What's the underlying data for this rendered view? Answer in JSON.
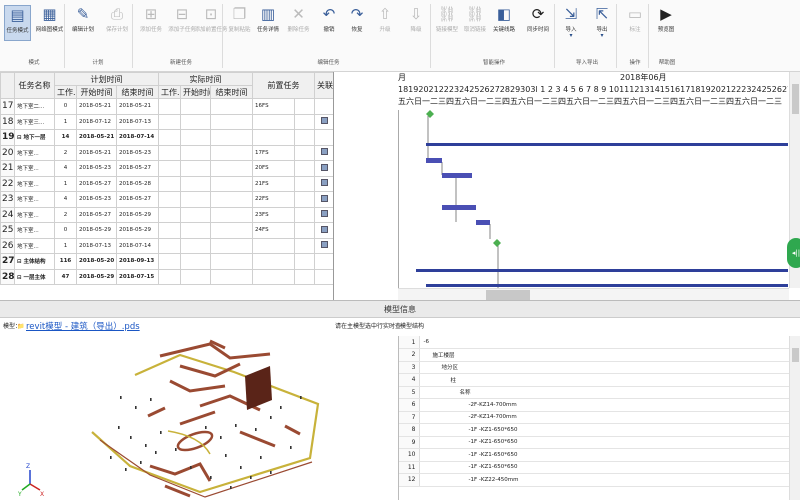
{
  "ribbon": {
    "buttons": [
      {
        "id": "task-mode",
        "label": "任务模式",
        "group": "mode",
        "active": true
      },
      {
        "id": "network-mode",
        "label": "网络图模式",
        "group": "mode"
      },
      {
        "id": "edit-plan",
        "label": "编辑计划",
        "group": "plan"
      },
      {
        "id": "save-plan",
        "label": "保存计划",
        "group": "plan",
        "disabled": true
      },
      {
        "id": "add-task",
        "label": "添加任务",
        "group": "new",
        "disabled": true
      },
      {
        "id": "add-subtask",
        "label": "添加子任务",
        "group": "new",
        "disabled": true
      },
      {
        "id": "add-preceding",
        "label": "添加前置任务",
        "group": "new",
        "disabled": true
      },
      {
        "id": "copy-paste",
        "label": "复制粘贴",
        "group": "edit",
        "disabled": true
      },
      {
        "id": "task-detail",
        "label": "任务详情",
        "group": "edit"
      },
      {
        "id": "delete-task",
        "label": "删除任务",
        "group": "edit",
        "disabled": true
      },
      {
        "id": "undo",
        "label": "撤销",
        "group": "edit"
      },
      {
        "id": "redo",
        "label": "恢复",
        "group": "edit"
      },
      {
        "id": "upgrade",
        "label": "升级",
        "group": "edit",
        "disabled": true
      },
      {
        "id": "downgrade",
        "label": "降级",
        "group": "edit",
        "disabled": true
      },
      {
        "id": "link-model",
        "label": "链接模型",
        "group": "smart",
        "disabled": true
      },
      {
        "id": "unlink",
        "label": "取消链接",
        "group": "smart",
        "disabled": true
      },
      {
        "id": "key-path",
        "label": "关键线路",
        "group": "smart"
      },
      {
        "id": "sync-time",
        "label": "同步时间",
        "group": "smart"
      },
      {
        "id": "import",
        "label": "导入",
        "group": "io",
        "dropdown": true
      },
      {
        "id": "export",
        "label": "导出",
        "group": "io",
        "dropdown": true
      },
      {
        "id": "mark",
        "label": "标注",
        "group": "ops",
        "disabled": true
      },
      {
        "id": "simulate",
        "label": "预览图",
        "group": "help"
      }
    ],
    "groups": {
      "mode": "模式",
      "plan": "计划",
      "new": "新建任务",
      "edit": "编辑任务",
      "smart": "智能操作",
      "io": "导入导出",
      "ops": "操作",
      "help": "帮助图"
    }
  },
  "grid": {
    "header_top": {
      "name": "任务名称",
      "plan": "计划时间",
      "actual": "实际时间",
      "pred": "前置任务",
      "assoc": "关联..."
    },
    "header_sub": {
      "work": "工作...",
      "start": "开始时间",
      "end": "结束时间",
      "awork": "工作...",
      "astart": "开始时间",
      "aend": "结束时间"
    },
    "rows": [
      {
        "num": "17",
        "name": "地下室二...",
        "work": "0",
        "start": "2018-05-21",
        "end": "2018-05-21",
        "pred": "16FS",
        "assoc": false
      },
      {
        "num": "18",
        "name": "地下室三...",
        "work": "1",
        "start": "2018-07-12",
        "end": "2018-07-13",
        "pred": "",
        "assoc": true
      },
      {
        "num": "19",
        "name": "⊟ 地下一层",
        "work": "14",
        "start": "2018-05-21",
        "end": "2018-07-14",
        "pred": "",
        "assoc": false,
        "bold": true
      },
      {
        "num": "20",
        "name": "地下室...",
        "work": "2",
        "start": "2018-05-21",
        "end": "2018-05-23",
        "pred": "17FS",
        "assoc": true
      },
      {
        "num": "21",
        "name": "地下室...",
        "work": "4",
        "start": "2018-05-23",
        "end": "2018-05-27",
        "pred": "20FS",
        "assoc": true
      },
      {
        "num": "22",
        "name": "地下室...",
        "work": "1",
        "start": "2018-05-27",
        "end": "2018-05-28",
        "pred": "21FS",
        "assoc": true
      },
      {
        "num": "23",
        "name": "地下室...",
        "work": "4",
        "start": "2018-05-23",
        "end": "2018-05-27",
        "pred": "22FS",
        "assoc": true
      },
      {
        "num": "24",
        "name": "地下室...",
        "work": "2",
        "start": "2018-05-27",
        "end": "2018-05-29",
        "pred": "23FS",
        "assoc": true
      },
      {
        "num": "25",
        "name": "地下室...",
        "work": "0",
        "start": "2018-05-29",
        "end": "2018-05-29",
        "pred": "24FS",
        "assoc": true
      },
      {
        "num": "26",
        "name": "地下室...",
        "work": "1",
        "start": "2018-07-13",
        "end": "2018-07-14",
        "pred": "",
        "assoc": true
      },
      {
        "num": "27",
        "name": "⊟ 主体结构",
        "work": "116",
        "start": "2018-05-20",
        "end": "2018-09-13",
        "pred": "",
        "assoc": false,
        "bold": true
      },
      {
        "num": "28",
        "name": "⊟ 一层主体",
        "work": "47",
        "start": "2018-05-29",
        "end": "2018-07-15",
        "pred": "",
        "assoc": false,
        "bold": true
      }
    ]
  },
  "gantt": {
    "timescale_left": "月",
    "month_label": "2018年06月",
    "days": "181920212223242526272829303l 1 2 3 4 5 6 7 8 9 101112131415161718192021222324252627282930 1 2",
    "weekdays": "五六日一二三四五六日一二三四五六日一二三四五六日一二三四五六日一二三四五六日一二三四五六日一二三"
  },
  "model": {
    "title": "模型信息",
    "model_label": "模型：",
    "model_file": "revit模型 - 建筑（导出）.pds",
    "highlight_label": "请在主模型选中行实时查",
    "tree_label": "模型结构"
  },
  "props": [
    {
      "n": "1",
      "text": "-6",
      "indent": 0
    },
    {
      "n": "2",
      "text": "施工楼层",
      "indent": 1
    },
    {
      "n": "3",
      "text": "地分区",
      "indent": 2
    },
    {
      "n": "4",
      "text": "柱",
      "indent": 3
    },
    {
      "n": "5",
      "text": "名称",
      "indent": 4
    },
    {
      "n": "6",
      "text": "-2F-KZ14-700mm",
      "indent": 5
    },
    {
      "n": "7",
      "text": "-2F-KZ14-700mm",
      "indent": 5
    },
    {
      "n": "8",
      "text": "-1F -KZ1-650*650",
      "indent": 5
    },
    {
      "n": "9",
      "text": "-1F -KZ1-650*650",
      "indent": 5
    },
    {
      "n": "10",
      "text": "-1F -KZ1-650*650",
      "indent": 5
    },
    {
      "n": "11",
      "text": "-1F -KZ1-650*650",
      "indent": 5
    },
    {
      "n": "12",
      "text": "-1F -KZ22-450mm",
      "indent": 5
    }
  ],
  "colors": {
    "bar": "#4a4fb4",
    "summary": "#2e3f9a",
    "milestone": "#4caf50",
    "model_brown": "#9a4a32",
    "model_yellow": "#c8b23a"
  }
}
